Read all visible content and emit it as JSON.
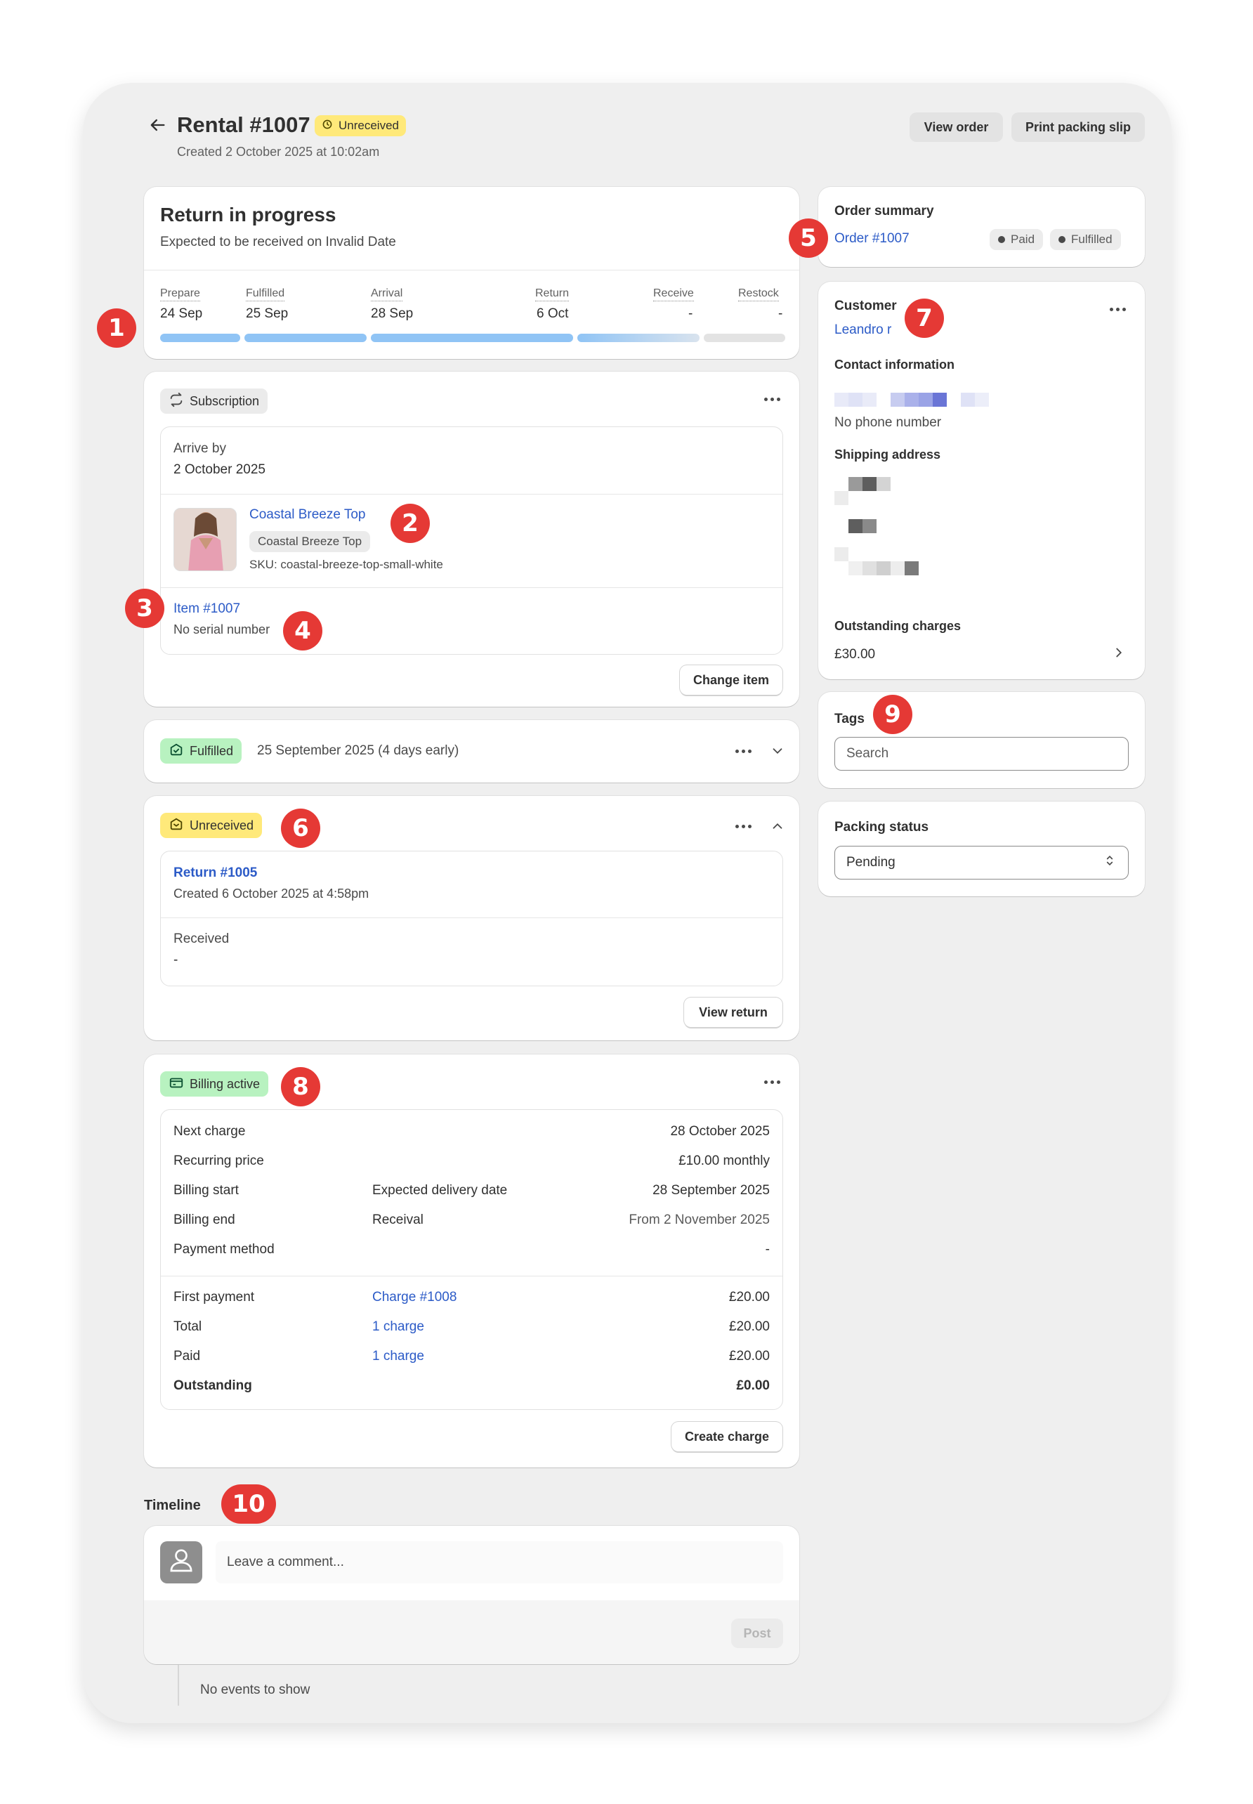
{
  "header": {
    "title": "Rental #1007",
    "status_badge": "Unreceived",
    "created": "Created 2 October 2025 at 10:02am",
    "view_order_label": "View order",
    "print_label": "Print packing slip"
  },
  "progress_card": {
    "title": "Return in progress",
    "subtitle": "Expected to be received on Invalid Date",
    "steps": [
      {
        "label": "Prepare",
        "value": "24 Sep",
        "state": "complete"
      },
      {
        "label": "Fulfilled",
        "value": "25 Sep",
        "state": "complete"
      },
      {
        "label": "Arrival",
        "value": "28 Sep",
        "state": "complete"
      },
      {
        "label": "Return",
        "value": "6 Oct",
        "state": "in-progress"
      },
      {
        "label": "Receive",
        "value": "-",
        "state": "pending"
      },
      {
        "label": "Restock",
        "value": "-",
        "state": "pending"
      }
    ]
  },
  "subscription_card": {
    "badge": "Subscription",
    "arrive_by_label": "Arrive by",
    "arrive_by_value": "2 October 2025",
    "product_name": "Coastal Breeze Top",
    "variant": "Coastal Breeze Top",
    "sku": "SKU: coastal-breeze-top-small-white",
    "item_link": "Item #1007",
    "serial": "No serial number",
    "change_item_label": "Change item"
  },
  "fulfilled_card": {
    "badge": "Fulfilled",
    "date": "25 September 2025 (4 days early)"
  },
  "unreceived_card": {
    "badge": "Unreceived",
    "return_link": "Return #1005",
    "return_created": "Created 6 October 2025 at 4:58pm",
    "received_label": "Received",
    "received_value": "-",
    "view_return_label": "View return"
  },
  "billing_card": {
    "badge": "Billing active",
    "rows": [
      {
        "label": "Next charge",
        "middle": "",
        "value": "28 October 2025"
      },
      {
        "label": "Recurring price",
        "middle": "",
        "value": "£10.00 monthly"
      },
      {
        "label": "Billing start",
        "middle": "Expected delivery date",
        "value": "28 September 2025"
      },
      {
        "label": "Billing end",
        "middle": "Receival",
        "value": "From 2 November 2025"
      },
      {
        "label": "Payment method",
        "middle": "",
        "value": "-"
      }
    ],
    "charges": [
      {
        "label": "First payment",
        "link": "Charge #1008",
        "value": "£20.00"
      },
      {
        "label": "Total",
        "link": "1 charge",
        "value": "£20.00"
      },
      {
        "label": "Paid",
        "link": "1 charge",
        "value": "£20.00"
      },
      {
        "label": "Outstanding",
        "link": "",
        "value": "£0.00"
      }
    ],
    "create_charge_label": "Create charge"
  },
  "timeline": {
    "title": "Timeline",
    "placeholder": "Leave a comment...",
    "post_label": "Post",
    "empty": "No events to show"
  },
  "order_summary": {
    "title": "Order summary",
    "order_link": "Order #1007",
    "paid_badge": "Paid",
    "fulfilled_badge": "Fulfilled"
  },
  "customer": {
    "title": "Customer",
    "name": "Leandro r",
    "contact_title": "Contact information",
    "phone": "No phone number",
    "shipping_title": "Shipping address",
    "outstanding_title": "Outstanding charges",
    "outstanding_value": "£30.00"
  },
  "tags": {
    "title": "Tags",
    "placeholder": "Search"
  },
  "packing": {
    "title": "Packing status",
    "value": "Pending"
  },
  "markers": [
    "1",
    "2",
    "3",
    "4",
    "5",
    "6",
    "7",
    "8",
    "9",
    "10"
  ],
  "colors": {
    "accent_link": "#2C5BC7",
    "marker": "#E53935",
    "progress_complete": "#90C4F5",
    "progress_pending": "#E3E3E3",
    "badge_yellow": "#FFE97A",
    "badge_green": "#B8F2C0"
  }
}
